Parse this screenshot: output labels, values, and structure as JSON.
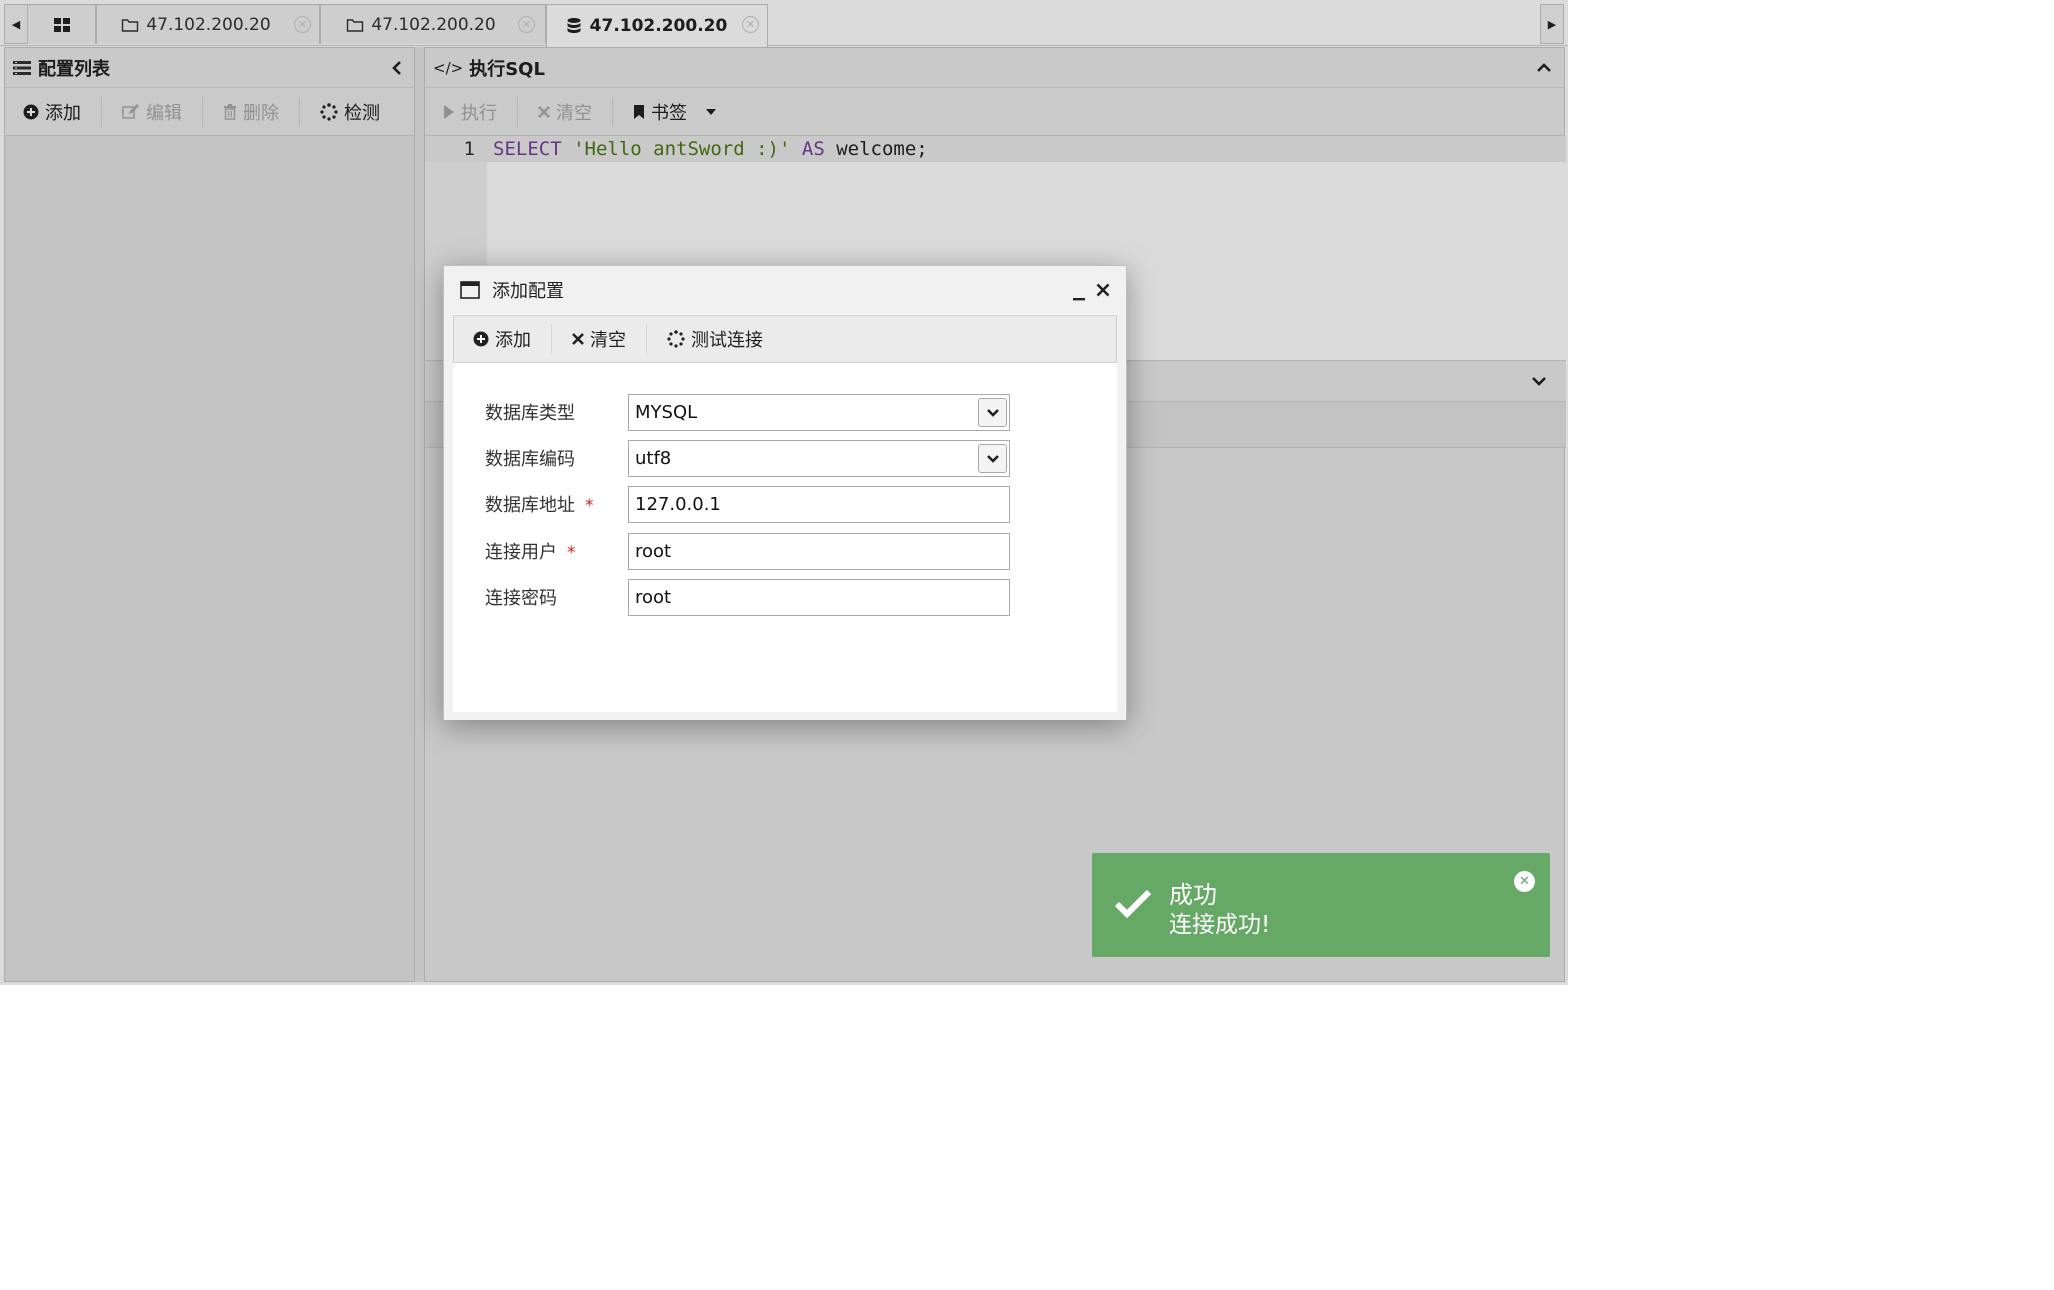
{
  "tabs": [
    {
      "icon": "grid-icon",
      "label": ""
    },
    {
      "icon": "folder-icon",
      "label": "47.102.200.20"
    },
    {
      "icon": "folder-icon",
      "label": "47.102.200.20"
    },
    {
      "icon": "database-icon",
      "label": "47.102.200.20",
      "active": true
    }
  ],
  "left_panel": {
    "title": "配置列表",
    "toolbar": {
      "add": "添加",
      "edit": "编辑",
      "delete": "删除",
      "detect": "检测"
    }
  },
  "right_panel": {
    "title": "执行SQL",
    "toolbar": {
      "execute": "执行",
      "clear": "清空",
      "bookmark": "书签"
    },
    "editor": {
      "line_number": "1",
      "code": {
        "kw1": "SELECT",
        "str": "'Hello antSword :)'",
        "kw2": "AS",
        "rest": "welcome;"
      }
    }
  },
  "dialog": {
    "title": "添加配置",
    "toolbar": {
      "add": "添加",
      "clear": "清空",
      "test": "测试连接"
    },
    "fields": {
      "db_type": {
        "label": "数据库类型",
        "value": "MYSQL"
      },
      "db_encoding": {
        "label": "数据库编码",
        "value": "utf8"
      },
      "db_host": {
        "label": "数据库地址",
        "value": "127.0.0.1",
        "required": "*"
      },
      "db_user": {
        "label": "连接用户",
        "value": "root",
        "required": "*"
      },
      "db_password": {
        "label": "连接密码",
        "value": "root"
      }
    }
  },
  "toast": {
    "title": "成功",
    "message": "连接成功!",
    "color": "#66a866"
  }
}
